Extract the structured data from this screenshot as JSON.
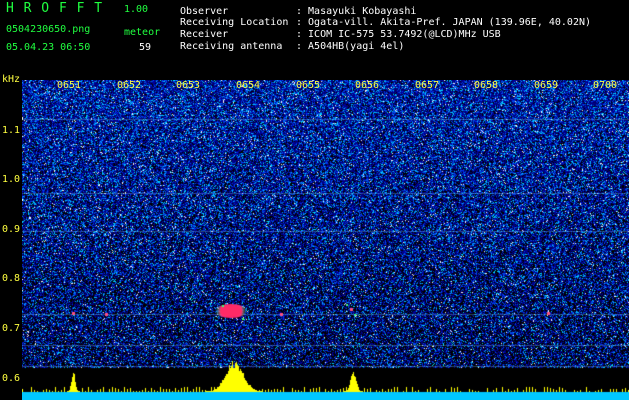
{
  "header": {
    "app_title": "H R O F F T",
    "version": "1.00",
    "filename": "0504230650.png",
    "meteor_label": "meteor",
    "meteor_count": "59",
    "datetime": "05.04.23 06:50",
    "rows": [
      {
        "key": "Observer",
        "value": ": Masayuki Kobayashi"
      },
      {
        "key": "Receiving Location",
        "value": ": Ogata-vill. Akita-Pref. JAPAN (139.96E, 40.02N)"
      },
      {
        "key": "Receiver",
        "value": ": ICOM IC-575 53.7492(@LCD)MHz USB"
      },
      {
        "key": "Receiving antenna",
        "value": ": A504HB(yagi 4el)"
      }
    ]
  },
  "axis": {
    "unit": "kHz",
    "y_ticks": [
      "1.1",
      "1.0",
      "0.9",
      "0.8",
      "0.7",
      "0.6"
    ],
    "time_ticks": [
      "0651",
      "0652",
      "0653",
      "0654",
      "0655",
      "0656",
      "0657",
      "0658",
      "0659",
      "0700"
    ]
  },
  "colors": {
    "background": "#000000",
    "label_green": "#20ff40",
    "label_yellow": "#ffff40",
    "echo": "#ff3060",
    "histogram": "#ffff00",
    "baseline": "#00c8ff"
  }
}
